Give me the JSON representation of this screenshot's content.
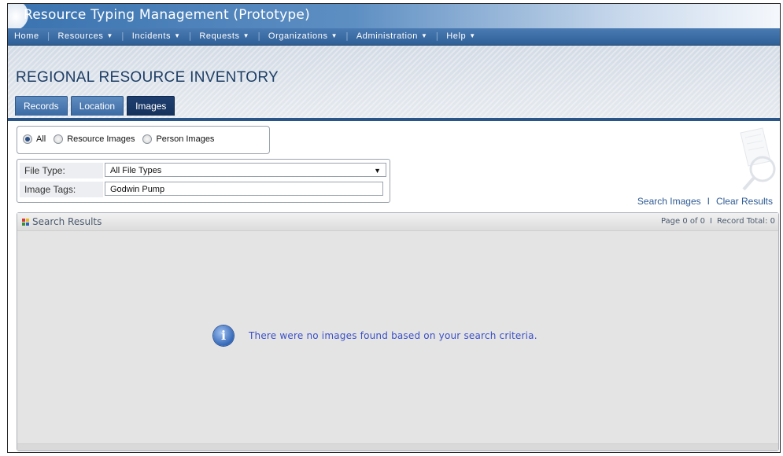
{
  "app": {
    "title": "Resource Typing Management (Prototype)"
  },
  "nav": {
    "items": [
      {
        "label": "Home",
        "dropdown": false
      },
      {
        "label": "Resources",
        "dropdown": true
      },
      {
        "label": "Incidents",
        "dropdown": true
      },
      {
        "label": "Requests",
        "dropdown": true
      },
      {
        "label": "Organizations",
        "dropdown": true
      },
      {
        "label": "Administration",
        "dropdown": true
      },
      {
        "label": "Help",
        "dropdown": true
      }
    ]
  },
  "page": {
    "title": "REGIONAL RESOURCE INVENTORY"
  },
  "tabs": [
    {
      "label": "Records",
      "active": false
    },
    {
      "label": "Location",
      "active": false
    },
    {
      "label": "Images",
      "active": true
    }
  ],
  "image_filter": {
    "options": [
      {
        "label": "All",
        "checked": true
      },
      {
        "label": "Resource Images",
        "checked": false
      },
      {
        "label": "Person Images",
        "checked": false
      }
    ]
  },
  "filters": {
    "file_type_label": "File Type:",
    "file_type_value": "All File Types",
    "image_tags_label": "Image Tags:",
    "image_tags_value": "Godwin Pump"
  },
  "actions": {
    "search_label": "Search Images",
    "clear_label": "Clear Results"
  },
  "results": {
    "title": "Search Results",
    "page_info": "Page 0 of 0",
    "record_total": "Record Total: 0",
    "empty_message": "There were no images found based on your search criteria."
  },
  "colors": {
    "nav_bar": "#3a6aa3",
    "active_tab": "#1a3866",
    "link": "#2e5b94",
    "message": "#3b4fc6"
  },
  "icons": {
    "results_icon": "grid-icon",
    "message_icon": "info-icon",
    "caret": "chevron-down-icon"
  }
}
